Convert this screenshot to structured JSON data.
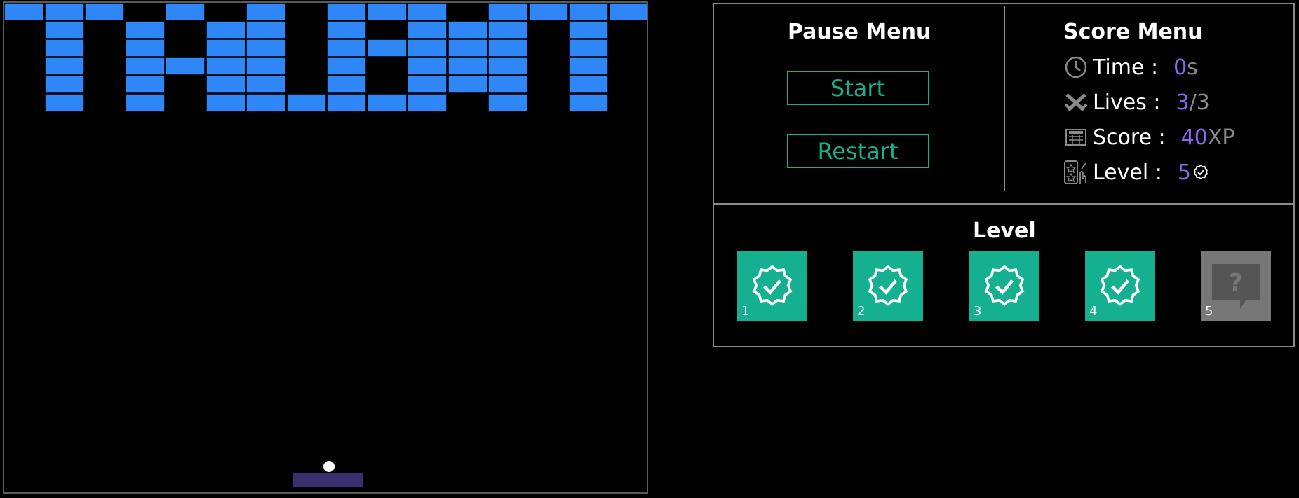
{
  "game": {
    "brick_color": "#2f86f6",
    "paddle_color": "#3a2f6e",
    "ball_color": "#ffffff",
    "bricks": [
      [
        0,
        0
      ],
      [
        1,
        0
      ],
      [
        2,
        0
      ],
      [
        4,
        0
      ],
      [
        6,
        0
      ],
      [
        8,
        0
      ],
      [
        9,
        0
      ],
      [
        10,
        0
      ],
      [
        12,
        0
      ],
      [
        13,
        0
      ],
      [
        14,
        0
      ],
      [
        15,
        0
      ],
      [
        1,
        1
      ],
      [
        3,
        1
      ],
      [
        5,
        1
      ],
      [
        6,
        1
      ],
      [
        8,
        1
      ],
      [
        10,
        1
      ],
      [
        11,
        1
      ],
      [
        12,
        1
      ],
      [
        14,
        1
      ],
      [
        1,
        2
      ],
      [
        3,
        2
      ],
      [
        5,
        2
      ],
      [
        6,
        2
      ],
      [
        8,
        2
      ],
      [
        9,
        2
      ],
      [
        10,
        2
      ],
      [
        11,
        2
      ],
      [
        12,
        2
      ],
      [
        14,
        2
      ],
      [
        1,
        3
      ],
      [
        3,
        3
      ],
      [
        4,
        3
      ],
      [
        5,
        3
      ],
      [
        6,
        3
      ],
      [
        8,
        3
      ],
      [
        10,
        3
      ],
      [
        11,
        3
      ],
      [
        12,
        3
      ],
      [
        14,
        3
      ],
      [
        1,
        4
      ],
      [
        3,
        4
      ],
      [
        5,
        4
      ],
      [
        6,
        4
      ],
      [
        8,
        4
      ],
      [
        10,
        4
      ],
      [
        11,
        4
      ],
      [
        12,
        4
      ],
      [
        14,
        4
      ],
      [
        1,
        5
      ],
      [
        3,
        5
      ],
      [
        5,
        5
      ],
      [
        6,
        5
      ],
      [
        7,
        5
      ],
      [
        8,
        5
      ],
      [
        9,
        5
      ],
      [
        10,
        5
      ],
      [
        12,
        5
      ],
      [
        14,
        5
      ]
    ]
  },
  "pause_menu": {
    "title": "Pause Menu",
    "start_label": "Start",
    "restart_label": "Restart"
  },
  "score_menu": {
    "title": "Score Menu",
    "time_label": "Time :",
    "time_value": "0",
    "time_unit": "s",
    "lives_label": "Lives :",
    "lives_value": "3",
    "lives_unit": "/3",
    "score_label": "Score :",
    "score_value": "40",
    "score_unit": "XP",
    "level_label": "Level :",
    "level_value": "5",
    "icons": [
      "clock-icon",
      "crossed-swords-icon",
      "scoreboard-icon",
      "level-card-icon"
    ]
  },
  "level_panel": {
    "title": "Level",
    "levels": [
      {
        "number": "1",
        "status": "completed"
      },
      {
        "number": "2",
        "status": "completed"
      },
      {
        "number": "3",
        "status": "completed"
      },
      {
        "number": "4",
        "status": "completed"
      },
      {
        "number": "5",
        "status": "locked"
      }
    ],
    "completed_color": "#14b08f",
    "locked_color": "#777777"
  },
  "colors": {
    "accent": "#14b08f",
    "value": "#8f63f0",
    "muted": "#8a8a8a"
  }
}
